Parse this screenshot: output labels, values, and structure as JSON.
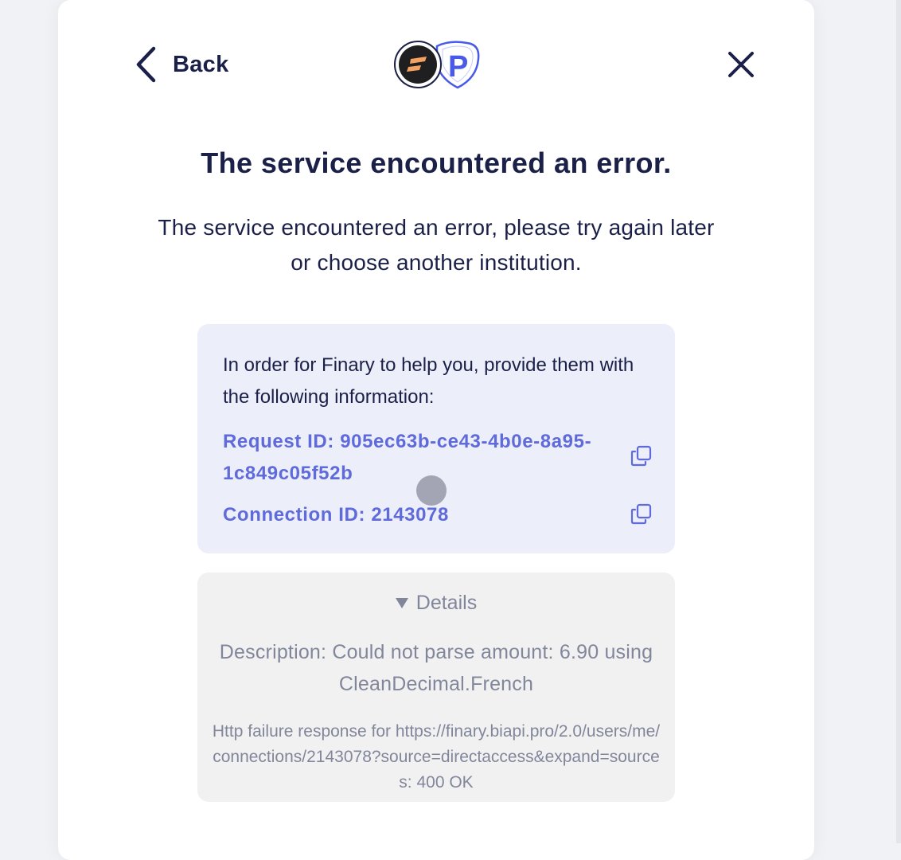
{
  "header": {
    "back_label": "Back",
    "back_icon": "chevron-left-icon",
    "close_icon": "close-icon",
    "logos": {
      "finary_icon": "finary-logo",
      "powens_icon": "powens-shield-logo",
      "powens_letter": "P"
    }
  },
  "error": {
    "title": "The service encountered an error.",
    "message": "The service encountered an error, please try again later or choose another institution."
  },
  "support_info": {
    "intro": "In order for Finary to help you, provide them with the following information:",
    "request_id": "Request ID: 905ec63b-ce43-4b0e-8a95-1c849c05f52b",
    "connection_id": "Connection ID: 2143078",
    "copy_icon": "copy-icon"
  },
  "details": {
    "toggle_label": "Details",
    "toggle_icon": "triangle-down-icon",
    "description": "Description: Could not parse amount: 6.90 using CleanDecimal.French",
    "http_error": "Http failure response for https://finary.biapi.pro/2.0/users/me/connections/2143078?source=directaccess&expand=sources: 400 OK"
  },
  "colors": {
    "text_primary": "#1b2048",
    "link_accent": "#5f6adb",
    "info_background": "#eceef9",
    "details_background": "#f1f1f2",
    "details_text": "#81869a",
    "finary_orange": "#f5a15f",
    "powens_blue": "#4a5ae8"
  }
}
